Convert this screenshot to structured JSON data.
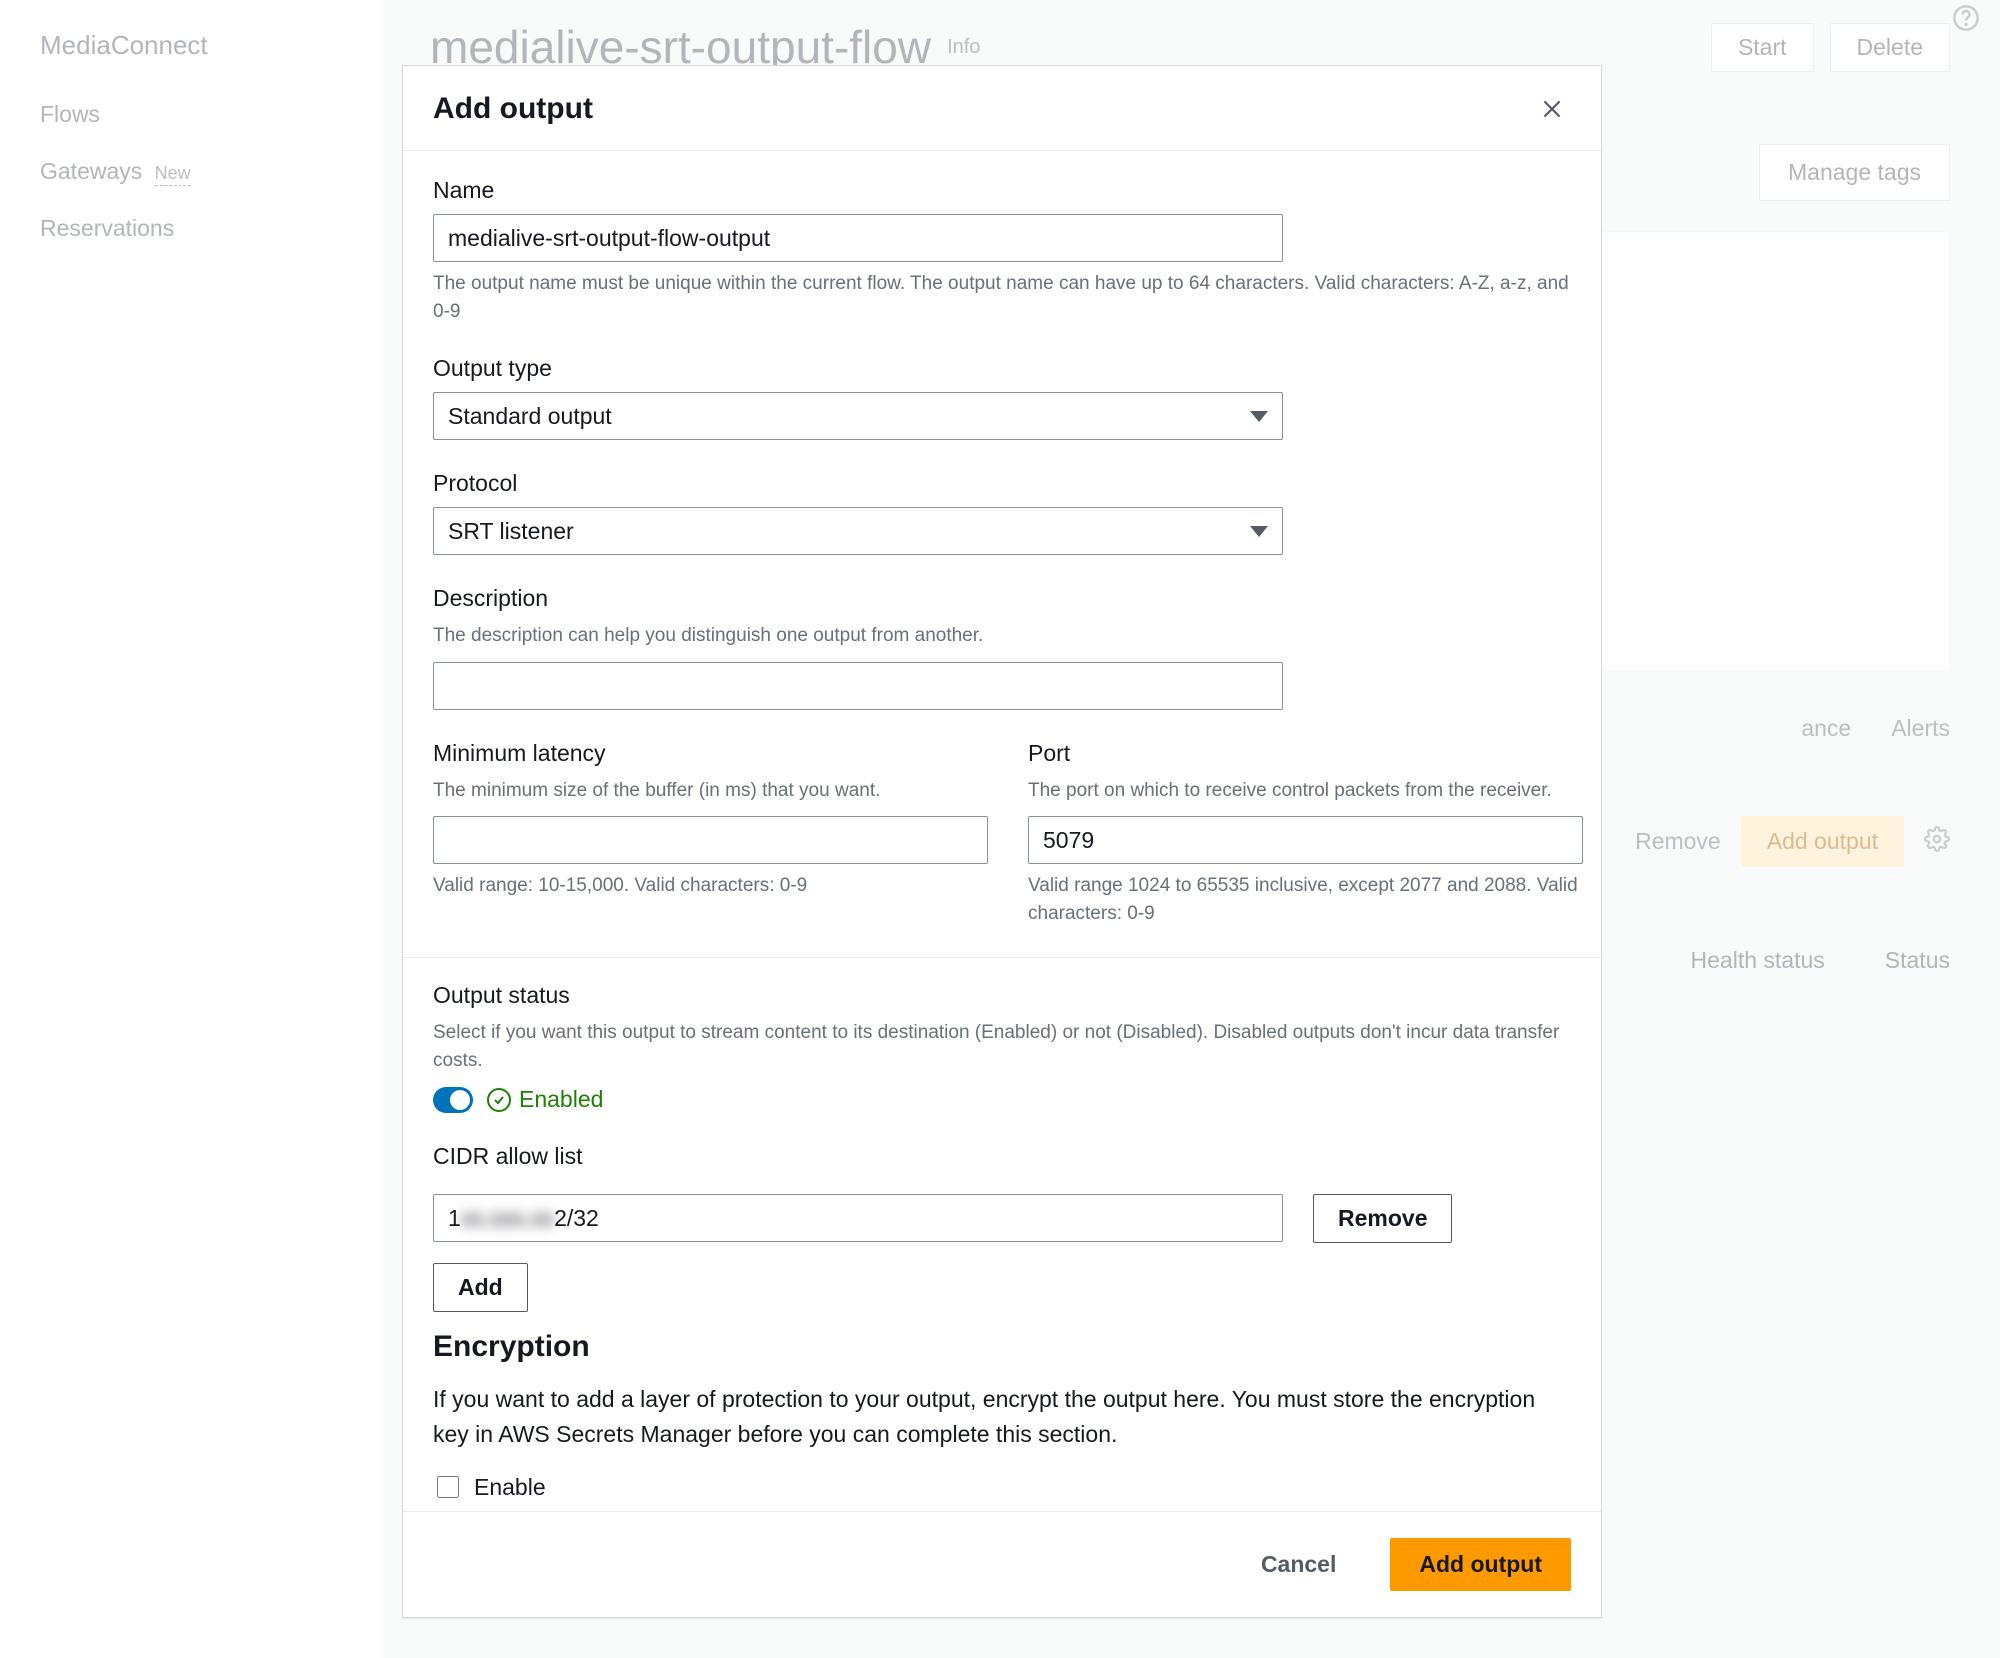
{
  "sidebar": {
    "service": "MediaConnect",
    "items": [
      "Flows",
      "Gateways",
      "Reservations"
    ],
    "new_badge": "New"
  },
  "page": {
    "title": "medialive-srt-output-flow",
    "info": "Info",
    "start": "Start",
    "delete": "Delete",
    "manage_tags": "Manage tags",
    "remove": "Remove",
    "add_output": "Add output",
    "tabs": [
      "ance",
      "Alerts"
    ]
  },
  "table": {
    "col_health": "Health status",
    "col_status": "Status"
  },
  "modal": {
    "title": "Add output",
    "name": {
      "label": "Name",
      "value": "medialive-srt-output-flow-output",
      "help": "The output name must be unique within the current flow. The output name can have up to 64 characters. Valid characters: A-Z, a-z, and 0-9"
    },
    "output_type": {
      "label": "Output type",
      "value": "Standard output"
    },
    "protocol": {
      "label": "Protocol",
      "value": "SRT listener"
    },
    "description": {
      "label": "Description",
      "sub": "The description can help you distinguish one output from another.",
      "value": ""
    },
    "min_latency": {
      "label": "Minimum latency",
      "sub": "The minimum size of the buffer (in ms) that you want.",
      "value": "",
      "help": "Valid range: 10-15,000. Valid characters: 0-9"
    },
    "port": {
      "label": "Port",
      "sub": "The port on which to receive control packets from the receiver.",
      "value": "5079",
      "help": "Valid range 1024 to 65535 inclusive, except 2077 and 2088. Valid characters: 0-9"
    },
    "output_status": {
      "label": "Output status",
      "sub": "Select if you want this output to stream content to its destination (Enabled) or not (Disabled). Disabled outputs don't incur data transfer costs.",
      "state": "Enabled"
    },
    "cidr": {
      "label": "CIDR allow list",
      "value_prefix": "1",
      "value_blur": "xx.xxx.xx",
      "value_suffix": "2/32",
      "remove": "Remove",
      "add": "Add"
    },
    "encryption": {
      "title": "Encryption",
      "desc": "If you want to add a layer of protection to your output, encrypt the output here. You must store the encryption key in AWS Secrets Manager before you can complete this section.",
      "enable": "Enable"
    },
    "footer": {
      "cancel": "Cancel",
      "submit": "Add output"
    }
  }
}
